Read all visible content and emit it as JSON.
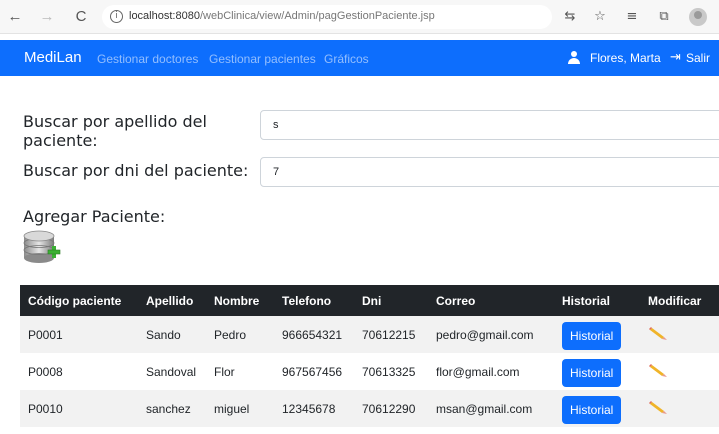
{
  "browser": {
    "back_icon": "arrow-left-icon",
    "forward_icon": "arrow-right-icon",
    "reload_icon": "reload-icon",
    "url_host": "localhost:8080",
    "url_path": "/webClinica/view/Admin/pagGestionPaciente.jsp"
  },
  "navbar": {
    "brand": "MediLan",
    "links": [
      "Gestionar doctores",
      "Gestionar pacientes",
      "Gráficos"
    ],
    "user": "Flores, Marta",
    "logout": "Salir",
    "color": "#0d6efd"
  },
  "search": {
    "apellido_label_line1": "Buscar por apellido del",
    "apellido_label_line2": "paciente:",
    "apellido_value": "s",
    "dni_label": "Buscar por dni del paciente:",
    "dni_value": "7"
  },
  "add_patient": {
    "heading": "Agregar Paciente:",
    "icon": "database-add-icon"
  },
  "table": {
    "headers": [
      "Código paciente",
      "Apellido",
      "Nombre",
      "Telefono",
      "Dni",
      "Correo",
      "Historial",
      "Modificar"
    ],
    "rows": [
      {
        "codigo": "P0001",
        "apellido": "Sando",
        "nombre": "Pedro",
        "telefono": "966654321",
        "dni": "70612215",
        "correo": "pedro@gmail.com",
        "historial": "Historial"
      },
      {
        "codigo": "P0008",
        "apellido": "Sandoval",
        "nombre": "Flor",
        "telefono": "967567456",
        "dni": "70613325",
        "correo": "flor@gmail.com",
        "historial": "Historial"
      },
      {
        "codigo": "P0010",
        "apellido": "sanchez",
        "nombre": "miguel",
        "telefono": "12345678",
        "dni": "70612290",
        "correo": "msan@gmail.com",
        "historial": "Historial"
      }
    ]
  }
}
